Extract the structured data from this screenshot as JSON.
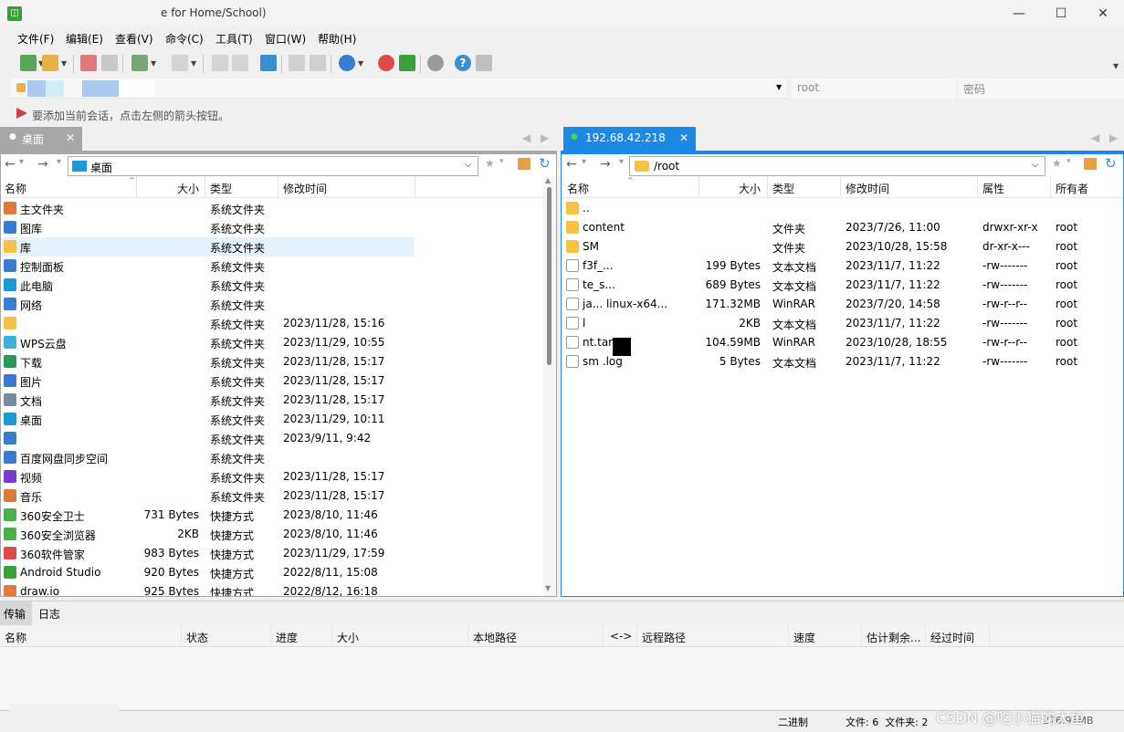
{
  "window": {
    "title": "e for Home/School)",
    "minimize": "—",
    "maximize": "☐",
    "close": "✕"
  },
  "menu": [
    "文件(F)",
    "编辑(E)",
    "查看(V)",
    "命令(C)",
    "工具(T)",
    "窗口(W)",
    "帮助(H)"
  ],
  "session": {
    "user": "root",
    "password_placeholder": "密码",
    "hint": "要添加当前会话，点击左侧的箭头按钮。"
  },
  "left_panel": {
    "tab": "桌面",
    "path": "桌面",
    "columns": [
      "名称",
      "大小",
      "类型",
      "修改时间"
    ],
    "rows": [
      {
        "name": "主文件夹",
        "size": "",
        "type": "系统文件夹",
        "mtime": ""
      },
      {
        "name": "图库",
        "size": "",
        "type": "系统文件夹",
        "mtime": ""
      },
      {
        "name": "库",
        "size": "",
        "type": "系统文件夹",
        "mtime": ""
      },
      {
        "name": "控制面板",
        "size": "",
        "type": "系统文件夹",
        "mtime": ""
      },
      {
        "name": "此电脑",
        "size": "",
        "type": "系统文件夹",
        "mtime": ""
      },
      {
        "name": "网络",
        "size": "",
        "type": "系统文件夹",
        "mtime": ""
      },
      {
        "name": "",
        "size": "",
        "type": "系统文件夹",
        "mtime": "2023/11/28, 15:16"
      },
      {
        "name": "WPS云盘",
        "size": "",
        "type": "系统文件夹",
        "mtime": "2023/11/29, 10:55"
      },
      {
        "name": "下载",
        "size": "",
        "type": "系统文件夹",
        "mtime": "2023/11/28, 15:17"
      },
      {
        "name": "图片",
        "size": "",
        "type": "系统文件夹",
        "mtime": "2023/11/28, 15:17"
      },
      {
        "name": "文档",
        "size": "",
        "type": "系统文件夹",
        "mtime": "2023/11/28, 15:17"
      },
      {
        "name": "桌面",
        "size": "",
        "type": "系统文件夹",
        "mtime": "2023/11/29, 10:11"
      },
      {
        "name": "",
        "size": "",
        "type": "系统文件夹",
        "mtime": "2023/9/11, 9:42"
      },
      {
        "name": "百度网盘同步空间",
        "size": "",
        "type": "系统文件夹",
        "mtime": ""
      },
      {
        "name": "视频",
        "size": "",
        "type": "系统文件夹",
        "mtime": "2023/11/28, 15:17"
      },
      {
        "name": "音乐",
        "size": "",
        "type": "系统文件夹",
        "mtime": "2023/11/28, 15:17"
      },
      {
        "name": "360安全卫士",
        "size": "731 Bytes",
        "type": "快捷方式",
        "mtime": "2023/8/10, 11:46"
      },
      {
        "name": "360安全浏览器",
        "size": "2KB",
        "type": "快捷方式",
        "mtime": "2023/8/10, 11:46"
      },
      {
        "name": "360软件管家",
        "size": "983 Bytes",
        "type": "快捷方式",
        "mtime": "2023/11/29, 17:59"
      },
      {
        "name": "Android Studio",
        "size": "920 Bytes",
        "type": "快捷方式",
        "mtime": "2022/8/11, 15:08"
      },
      {
        "name": "draw.io",
        "size": "925 Bytes",
        "type": "快捷方式",
        "mtime": "2022/8/12, 16:18"
      }
    ]
  },
  "right_panel": {
    "tab": "192.68.42.218",
    "path": "/root",
    "columns": [
      "名称",
      "大小",
      "类型",
      "修改时间",
      "属性",
      "所有者"
    ],
    "rows": [
      {
        "name": "..",
        "size": "",
        "type": "",
        "mtime": "",
        "attr": "",
        "owner": ""
      },
      {
        "name": "content",
        "size": "",
        "type": "文件夹",
        "mtime": "2023/7/26, 11:00",
        "attr": "drwxr-xr-x",
        "owner": "root"
      },
      {
        "name": "SM",
        "size": "",
        "type": "文件夹",
        "mtime": "2023/10/28, 15:58",
        "attr": "dr-xr-x---",
        "owner": "root"
      },
      {
        "name": "f3f_...",
        "size": "199 Bytes",
        "type": "文本文档",
        "mtime": "2023/11/7, 11:22",
        "attr": "-rw-------",
        "owner": "root"
      },
      {
        "name": "te_s...",
        "size": "689 Bytes",
        "type": "文本文档",
        "mtime": "2023/11/7, 11:22",
        "attr": "-rw-------",
        "owner": "root"
      },
      {
        "name": "ja... linux-x64...",
        "size": "171.32MB",
        "type": "WinRAR",
        "mtime": "2023/7/20, 14:58",
        "attr": "-rw-r--r--",
        "owner": "root"
      },
      {
        "name": "l",
        "size": "2KB",
        "type": "文本文档",
        "mtime": "2023/11/7, 11:22",
        "attr": "-rw-------",
        "owner": "root"
      },
      {
        "name": "nt.tar.gz",
        "size": "104.59MB",
        "type": "WinRAR",
        "mtime": "2023/10/28, 18:55",
        "attr": "-rw-r--r--",
        "owner": "root"
      },
      {
        "name": "sm   .log",
        "size": "5 Bytes",
        "type": "文本文档",
        "mtime": "2023/11/7, 11:22",
        "attr": "-rw-------",
        "owner": "root"
      }
    ]
  },
  "bottom": {
    "tabs": [
      "传输",
      "日志"
    ],
    "columns": [
      "名称",
      "状态",
      "进度",
      "大小",
      "本地路径",
      "<->",
      "远程路径",
      "速度",
      "估计剩余...",
      "经过时间"
    ]
  },
  "status": {
    "mode": "二进制",
    "counts": "文件: 6  文件夹: 2",
    "total": "276.91MB",
    "watermark": "CSDN @吃小猫的大鱼"
  }
}
